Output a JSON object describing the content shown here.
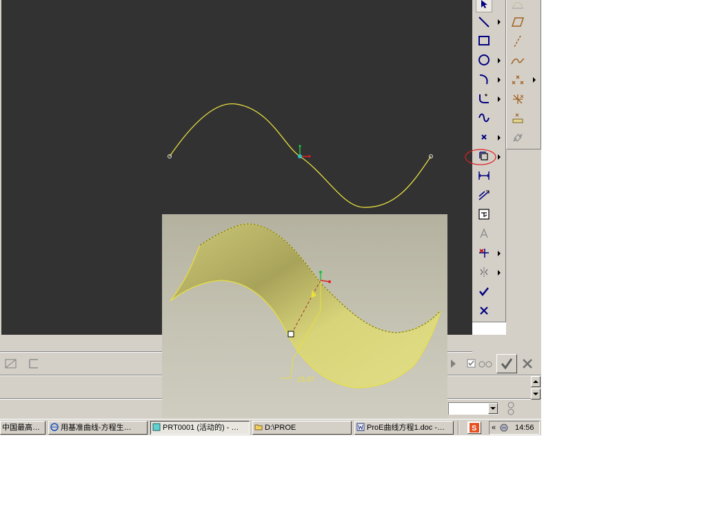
{
  "taskbar": {
    "items": [
      {
        "label": "中国最高…",
        "icon": "app-icon"
      },
      {
        "label": "用基准曲线-方程生…",
        "icon": "ie-icon"
      },
      {
        "label": "PRT0001 (活动的) - …",
        "icon": "proe-icon"
      },
      {
        "label": "D:\\PROE",
        "icon": "folder-icon"
      },
      {
        "label": "ProE曲线方程1.doc -…",
        "icon": "word-icon"
      }
    ],
    "tray": {
      "chevron": "«",
      "time": "14:56"
    }
  },
  "inset": {
    "dimension_label": "15.97"
  },
  "toolbar_main": {
    "tools": [
      "select-arrow-icon",
      "line-icon",
      "rectangle-icon",
      "circle-icon",
      "arc-icon",
      "fillet-icon",
      "spline-icon",
      "point-icon",
      "use-edge-icon",
      "dimension-icon",
      "modify-icon",
      "constraint-icon",
      "text-icon",
      "trim-icon",
      "mirror-icon",
      "done-check-icon",
      "quit-x-icon"
    ]
  },
  "toolbar_secondary": {
    "tools": [
      "datum-plane-icon",
      "datum-axis-icon",
      "datum-curve-icon",
      "datum-point-icon",
      "coordinate-system-icon",
      "analysis-icon",
      "link-icon"
    ]
  },
  "colors": {
    "viewport_bg": "#323232",
    "curve": "#e8e040",
    "surface": "#d8d47a",
    "ui_face": "#d4d0c8"
  }
}
